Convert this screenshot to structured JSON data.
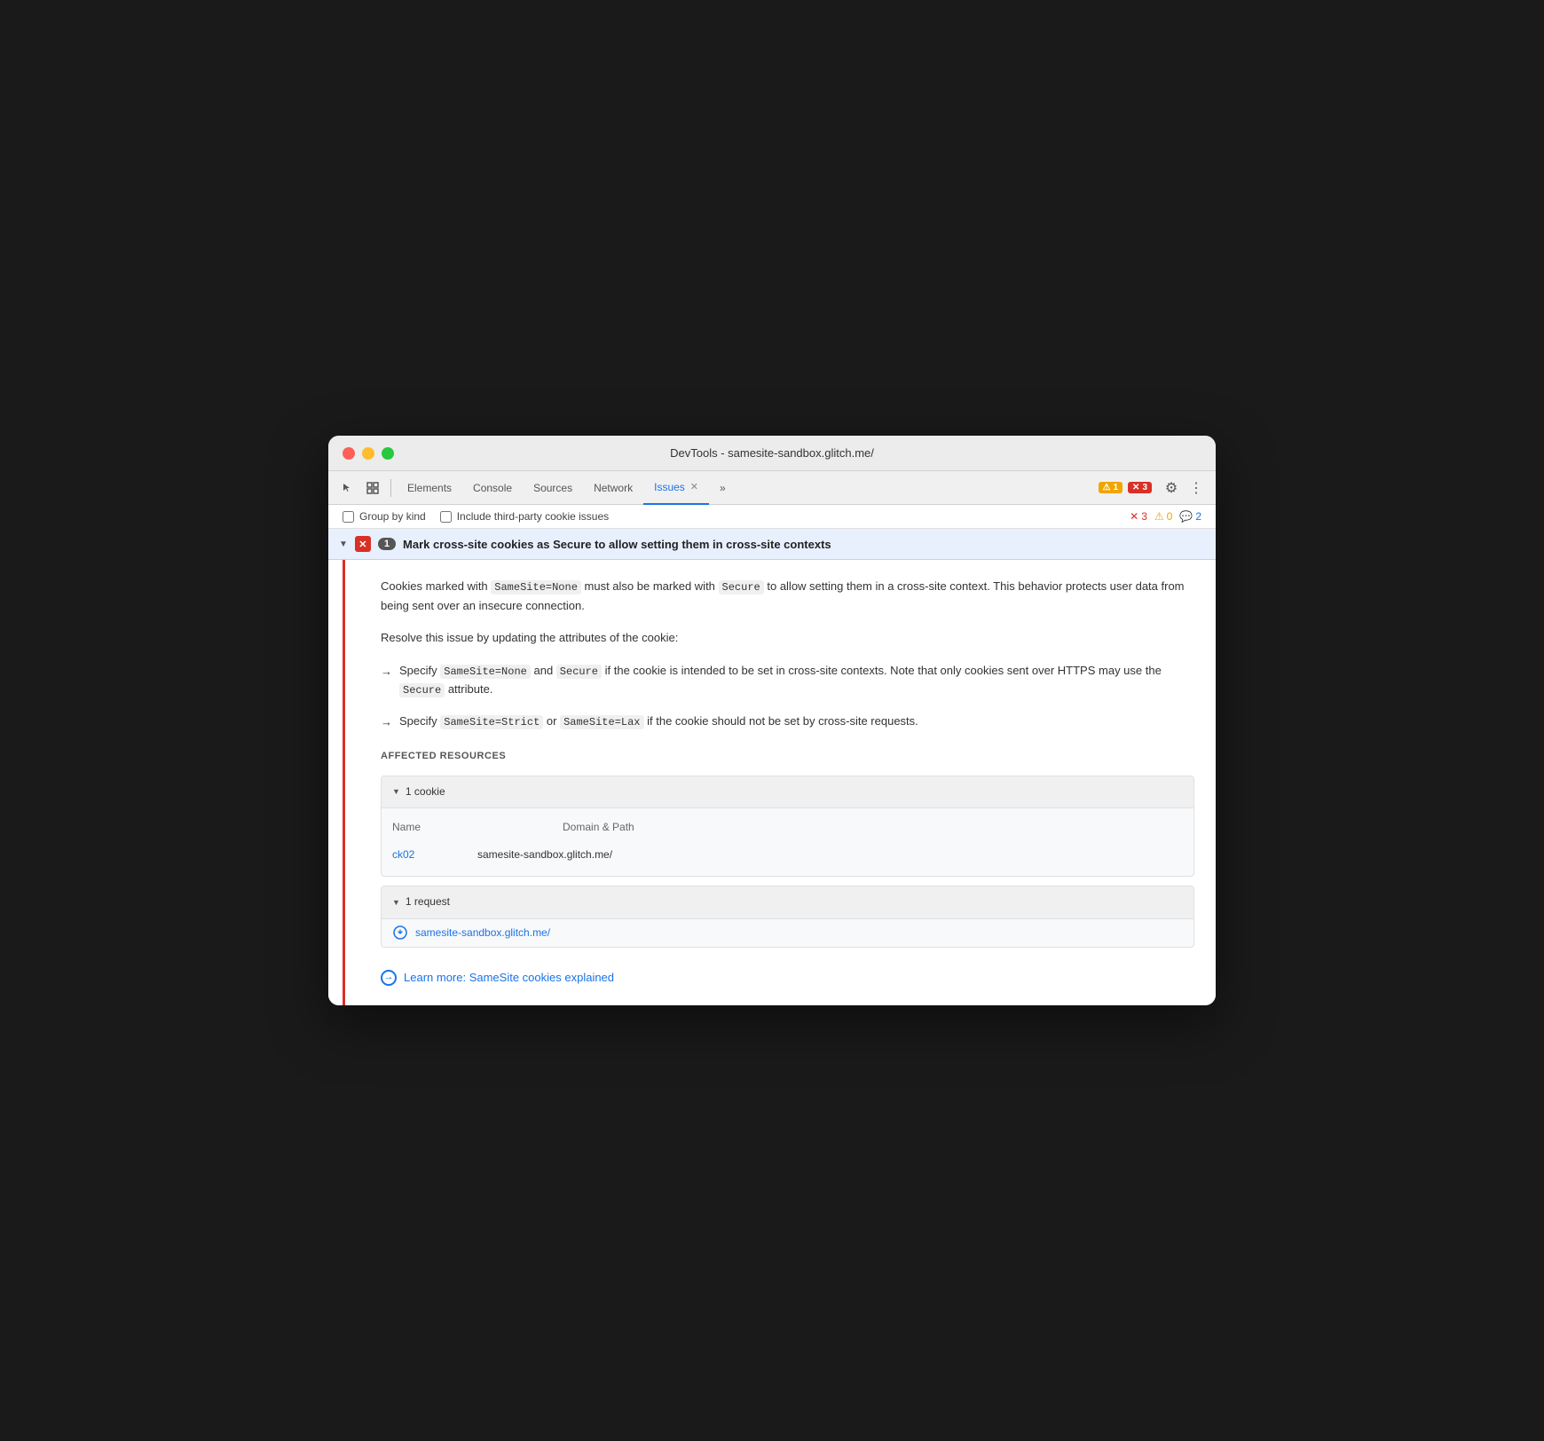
{
  "window": {
    "title": "DevTools - samesite-sandbox.glitch.me/"
  },
  "tabs": {
    "items": [
      {
        "label": "Elements",
        "active": false
      },
      {
        "label": "Console",
        "active": false
      },
      {
        "label": "Sources",
        "active": false
      },
      {
        "label": "Network",
        "active": false
      },
      {
        "label": "Issues",
        "active": true,
        "closable": true
      },
      {
        "label": "»",
        "active": false
      }
    ]
  },
  "badges": {
    "warning_count": "1",
    "error_count": "3"
  },
  "filter": {
    "group_by_kind": "Group by kind",
    "third_party": "Include third-party cookie issues",
    "error_count": "3",
    "warning_count": "0",
    "info_count": "2"
  },
  "issue": {
    "title": "Mark cross-site cookies as Secure to allow setting them in cross-site contexts",
    "count": "1",
    "body_para1_prefix": "Cookies marked with ",
    "code1": "SameSite=None",
    "body_para1_mid": " must also be marked with ",
    "code2": "Secure",
    "body_para1_suffix": " to allow setting them in a cross-site context. This behavior protects user data from being sent over an insecure connection.",
    "body_para2": "Resolve this issue by updating the attributes of the cookie:",
    "bullet1_prefix": "Specify ",
    "bullet1_code1": "SameSite=None",
    "bullet1_mid": " and ",
    "bullet1_code2": "Secure",
    "bullet1_suffix": " if the cookie is intended to be set in cross-site contexts. Note that only cookies sent over HTTPS may use the ",
    "bullet1_code3": "Secure",
    "bullet1_end": " attribute.",
    "bullet2_prefix": "Specify ",
    "bullet2_code1": "SameSite=Strict",
    "bullet2_mid": " or ",
    "bullet2_code2": "SameSite=Lax",
    "bullet2_suffix": " if the cookie should not be set by cross-site requests.",
    "affected_label": "Affected Resources",
    "cookie_group": "1 cookie",
    "cookie_col_name": "Name",
    "cookie_col_domain": "Domain & Path",
    "cookie_name": "ck02",
    "cookie_domain": "samesite-sandbox.glitch.me/",
    "request_group": "1 request",
    "request_url": "samesite-sandbox.glitch.me/",
    "learn_more_text": "Learn more: SameSite cookies explained"
  }
}
